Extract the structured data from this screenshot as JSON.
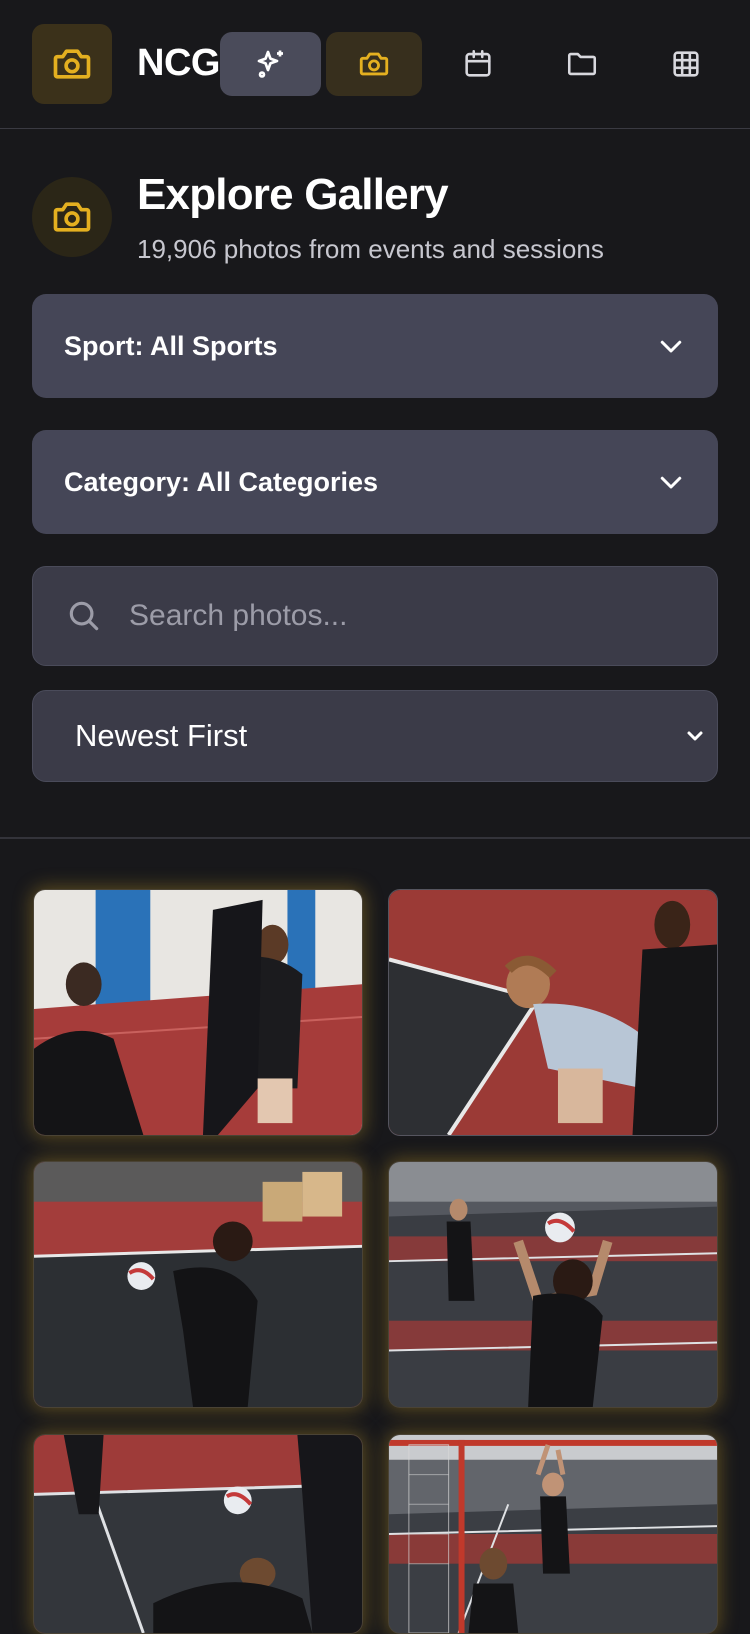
{
  "header": {
    "brand": "NCG",
    "nav": [
      {
        "name": "ai-sparkles",
        "icon": "sparkles-icon"
      },
      {
        "name": "photos",
        "icon": "camera-icon"
      },
      {
        "name": "calendar",
        "icon": "calendar-icon"
      },
      {
        "name": "folders",
        "icon": "folder-icon"
      },
      {
        "name": "grid",
        "icon": "grid-icon"
      }
    ]
  },
  "hero": {
    "title": "Explore Gallery",
    "subtitle": "19,906 photos from events and sessions"
  },
  "filters": {
    "sport_label": "Sport: All Sports",
    "category_label": "Category: All Categories",
    "search_placeholder": "Search photos...",
    "search_value": "",
    "sort_label": "Newest First"
  },
  "photos": [
    {
      "subject": "volleyball players cheering"
    },
    {
      "subject": "player crouched ready on court"
    },
    {
      "subject": "player passing ball"
    },
    {
      "subject": "player setting ball"
    },
    {
      "subject": "player diving for ball"
    },
    {
      "subject": "player serving near net"
    }
  ],
  "colors": {
    "background": "#18181b",
    "accent": "#e4b020",
    "card": "#454657",
    "input": "#3b3b48"
  }
}
